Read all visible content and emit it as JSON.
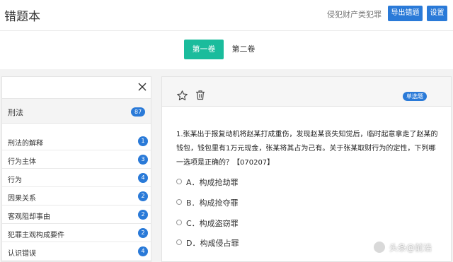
{
  "header": {
    "title": "错题本",
    "category": "侵犯财产类犯罪",
    "export_label": "导出错题",
    "settings_label": "设置"
  },
  "tabs": [
    {
      "label": "第一卷",
      "active": true
    },
    {
      "label": "第二卷",
      "active": false
    }
  ],
  "sidebar": {
    "category": {
      "label": "刑法",
      "count": "87"
    },
    "items": [
      {
        "label": "刑法的解释",
        "count": "1"
      },
      {
        "label": "行为主体",
        "count": "3"
      },
      {
        "label": "行为",
        "count": "4"
      },
      {
        "label": "因果关系",
        "count": "2"
      },
      {
        "label": "客观阻却事由",
        "count": "2"
      },
      {
        "label": "犯罪主观构成要件",
        "count": "2"
      },
      {
        "label": "认识错误",
        "count": "4"
      }
    ]
  },
  "question": {
    "type_badge": "单选题",
    "text": "1.张某出于报复动机将赵某打成重伤，发现赵某丧失知觉后，临时起意拿走了赵某的钱包，钱包里有1万元现金，张某将其占为己有。关于张某取财行为的定性，下列哪一选项是正确的？【070207】",
    "options": [
      "A．构成抢劫罪",
      "B．构成抢夺罪",
      "C．构成盗窃罪",
      "D．构成侵占罪"
    ]
  },
  "watermark": {
    "text": "头条@前沿"
  },
  "colors": {
    "primary": "#2a7ad8",
    "tab_active": "#1abc9c"
  }
}
